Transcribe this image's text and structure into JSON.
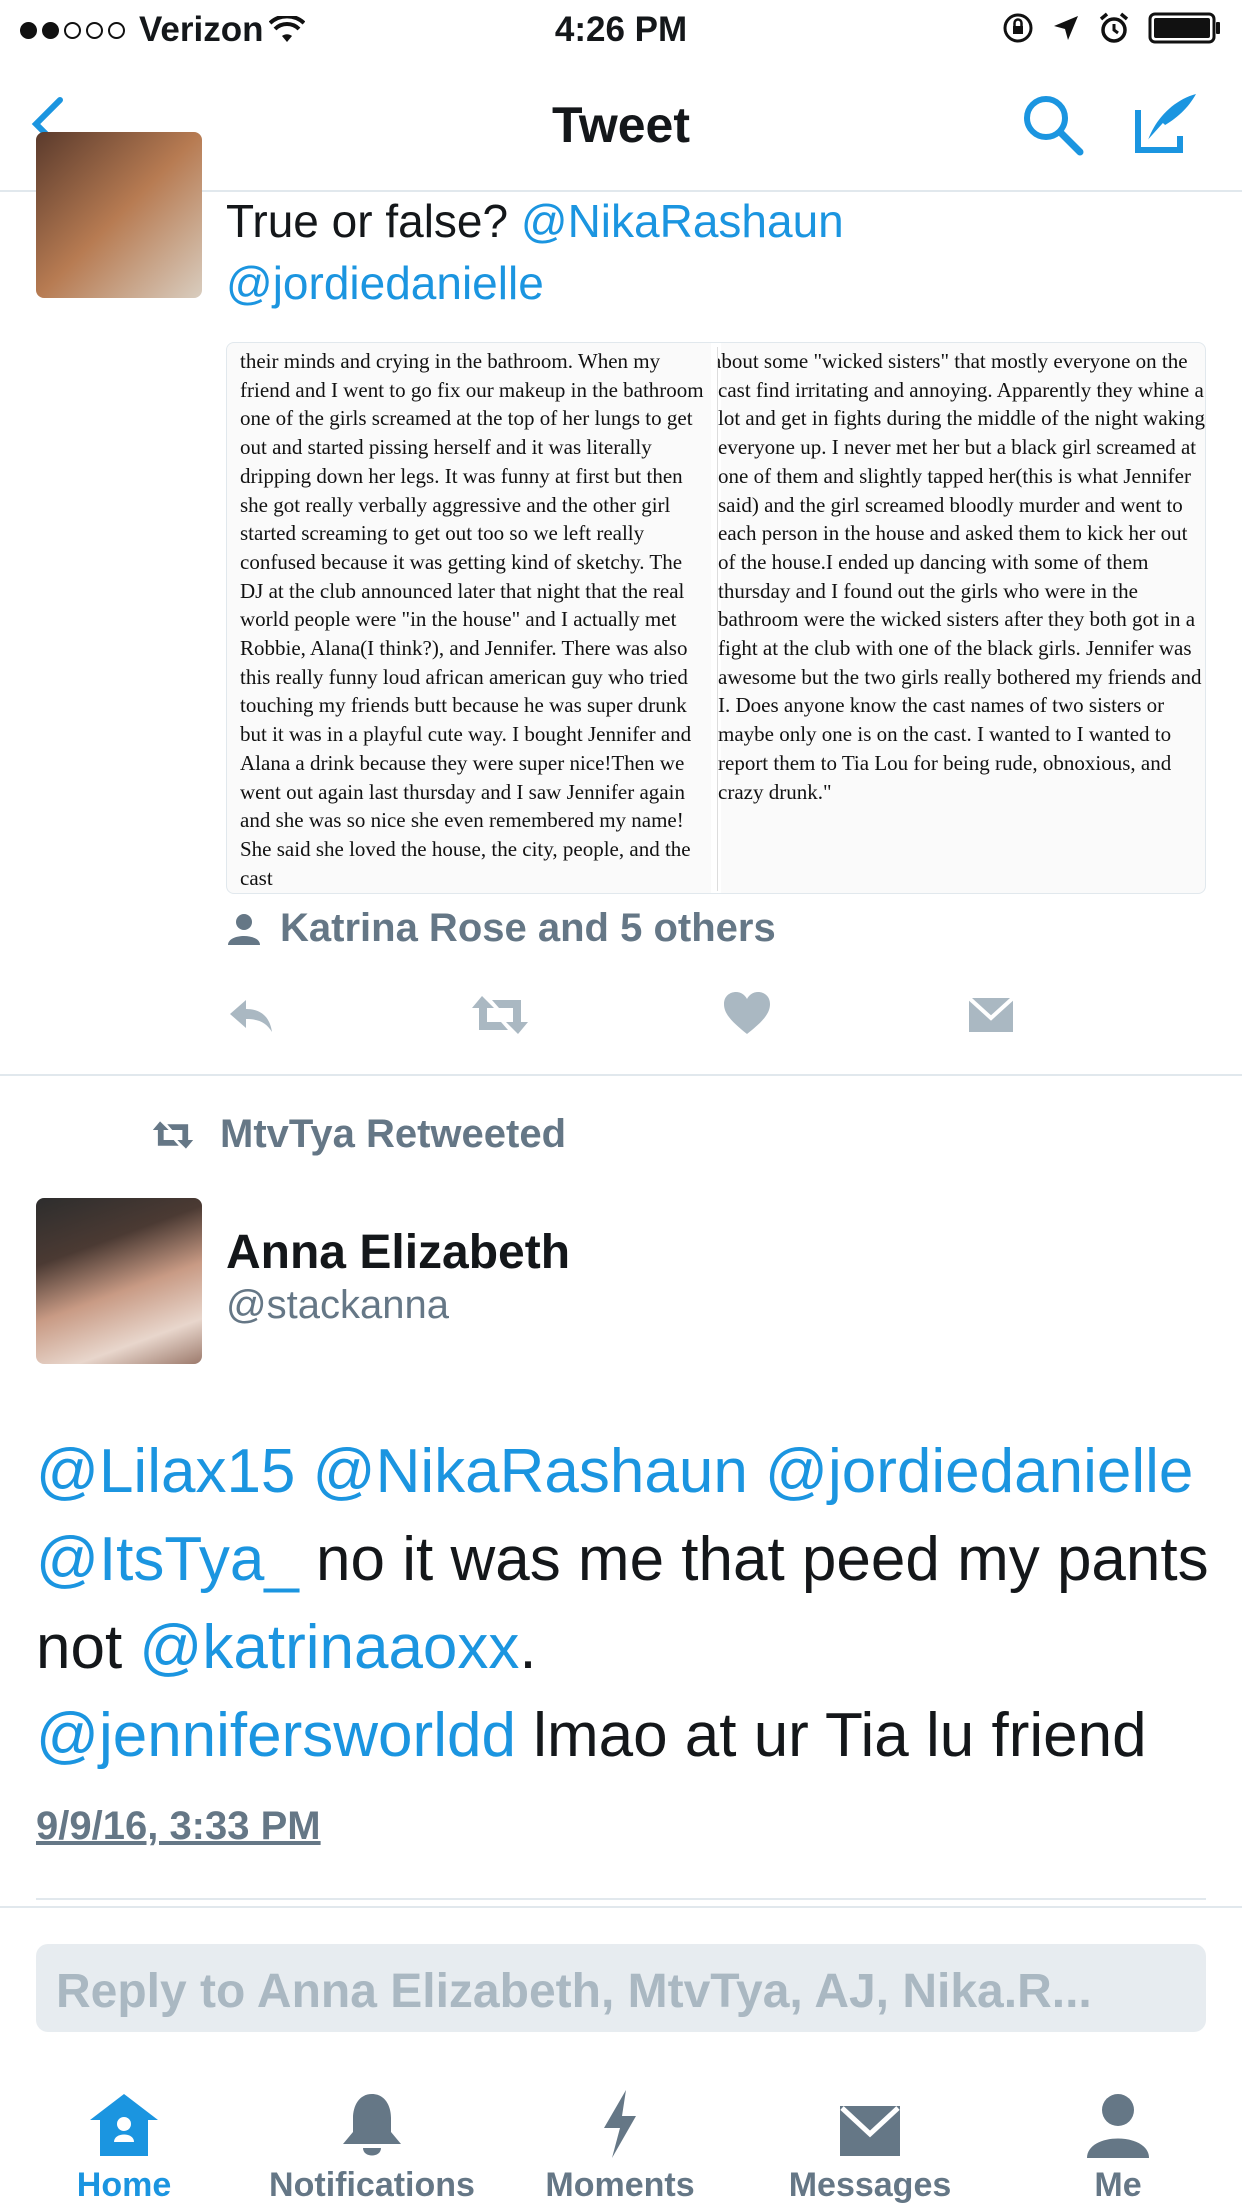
{
  "status_bar": {
    "carrier": "Verizon",
    "time": "4:26 PM"
  },
  "nav": {
    "title": "Tweet"
  },
  "tweet1": {
    "text_prefix": "True or false? ",
    "mention1": "@NikaRashaun",
    "mention2": "@jordiedanielle",
    "image_text_left": "their minds and crying in the bathroom. When my friend and I went to go fix our makeup in the bathroom one of the girls screamed at the top of her lungs to get out and started pissing herself and it was literally dripping down her legs. It was funny at first but then she got really verbally aggressive and the other girl started screaming to get out too so we left really confused because it was getting kind of sketchy. The DJ at the club announced later that night that the real world people were \"in the house\" and I actually met Robbie, Alana(I think?), and Jennifer. There was also this really funny loud african american guy who tried touching my friends butt because he was super drunk but it was in a playful cute way. I bought Jennifer and Alana a drink because they were super nice!Then we went out again last thursday and I saw Jennifer again and she was so nice she even remembered my name! She said she loved the house, the city, people, and the cast",
    "image_text_right": "about some \"wicked sisters\" that mostly everyone on the cast find irritating and annoying. Apparently they whine a lot and get in fights during the middle of the night waking everyone up. I never met her but a black girl screamed at one of them and slightly tapped her(this is what Jennifer said) and the girl screamed bloodly murder and went to each person in the house and asked them to kick her out of the house.I ended up dancing with some of them thursday and I found out the girls who were in the bathroom were the wicked sisters after they both got in a fight at the club with one of the black girls. Jennifer was awesome but the two girls really bothered my friends and I. Does anyone know the cast names of two sisters or maybe only one is on the cast. I wanted to I wanted to report them to Tia Lou for being rude, obnoxious, and crazy drunk.\"",
    "likers": "Katrina Rose and 5 others"
  },
  "retweet": {
    "label": "MtvTya Retweeted"
  },
  "tweet2": {
    "author_name": "Anna Elizabeth",
    "author_handle": "@stackanna",
    "m1": "@Lilax15",
    "m2": "@NikaRashaun",
    "m3": "@jordiedanielle",
    "m4": "@ItsTya_",
    "t1": " no it was me that peed my pants not ",
    "m5": "@katrinaaoxx",
    "t2": ".",
    "m6": "@jennifersworldd",
    "t3": " lmao at ur Tia lu friend",
    "timestamp": "9/9/16, 3:33 PM"
  },
  "reply": {
    "placeholder": "Reply to Anna Elizabeth, MtvTya, AJ, Nika.R..."
  },
  "tabs": [
    {
      "label": "Home",
      "icon": "home-icon"
    },
    {
      "label": "Notifications",
      "icon": "bell-icon"
    },
    {
      "label": "Moments",
      "icon": "lightning-icon"
    },
    {
      "label": "Messages",
      "icon": "envelope-icon"
    },
    {
      "label": "Me",
      "icon": "person-icon"
    }
  ],
  "colors": {
    "accent": "#1b95e0",
    "secondary_text": "#657786",
    "icon_gray": "#aab8c2"
  }
}
